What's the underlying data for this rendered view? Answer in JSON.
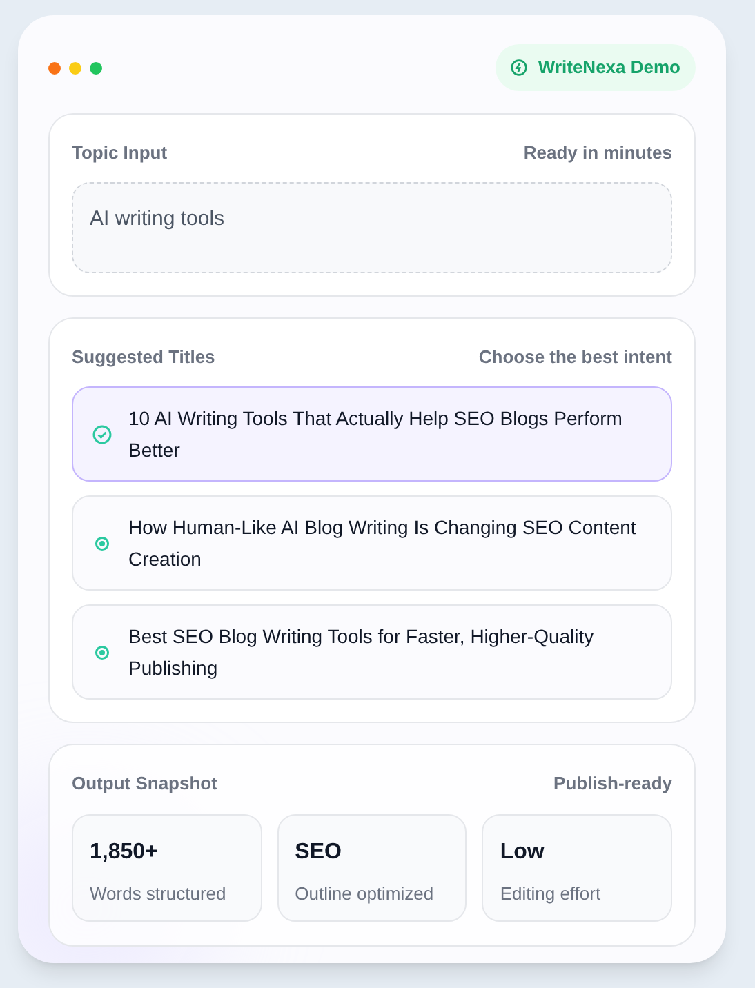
{
  "badge": {
    "label": "WriteNexa Demo"
  },
  "topic": {
    "title": "Topic Input",
    "note": "Ready in minutes",
    "value": "AI writing tools"
  },
  "titles": {
    "title": "Suggested Titles",
    "note": "Choose the best intent",
    "items": [
      {
        "label": "10 AI Writing Tools That Actually Help SEO Blogs Perform Better",
        "selected": true
      },
      {
        "label": "How Human-Like AI Blog Writing Is Changing SEO Content Creation",
        "selected": false
      },
      {
        "label": "Best SEO Blog Writing Tools for Faster, Higher-Quality Publishing",
        "selected": false
      }
    ]
  },
  "snapshot": {
    "title": "Output Snapshot",
    "note": "Publish-ready",
    "stats": [
      {
        "value": "1,850+",
        "label": "Words structured"
      },
      {
        "value": "SEO",
        "label": "Outline optimized"
      },
      {
        "value": "Low",
        "label": "Editing effort"
      }
    ]
  }
}
